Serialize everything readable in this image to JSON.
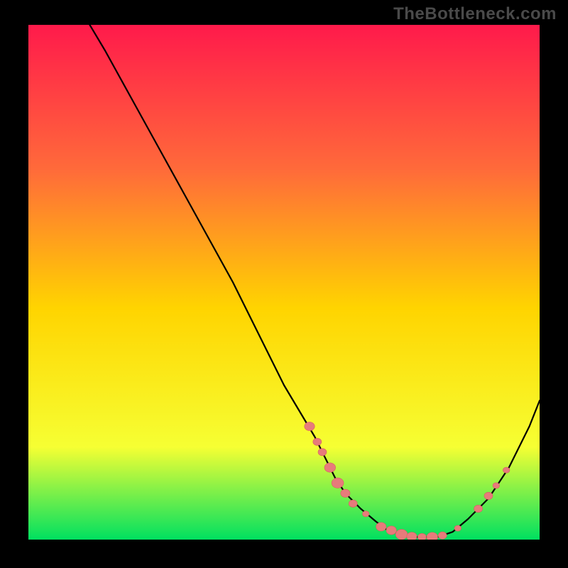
{
  "watermark": "TheBottleneck.com",
  "colors": {
    "gradient_top": "#ff1a4b",
    "gradient_mid_upper": "#ff6a3a",
    "gradient_mid": "#ffd400",
    "gradient_mid_lower": "#f6ff33",
    "gradient_bottom": "#00e060",
    "curve": "#000000",
    "marker": "#e77b7b",
    "marker_stroke": "#d85f5f"
  },
  "chart_data": {
    "type": "line",
    "title": "",
    "xlabel": "",
    "ylabel": "",
    "xlim": [
      0,
      100
    ],
    "ylim": [
      0,
      100
    ],
    "grid": false,
    "legend": false,
    "series": [
      {
        "name": "curve",
        "x": [
          12,
          15,
          20,
          25,
          30,
          35,
          40,
          45,
          48,
          50,
          53,
          56,
          58,
          60,
          62,
          65,
          68,
          70,
          73,
          76,
          80,
          83,
          86,
          90,
          94,
          98,
          100
        ],
        "y": [
          100,
          95,
          86,
          77,
          68,
          59,
          50,
          40,
          34,
          30,
          25,
          20,
          16,
          12,
          9,
          6,
          3.5,
          2,
          1,
          0.5,
          0.5,
          1.5,
          4,
          8,
          14,
          22,
          27
        ]
      }
    ],
    "markers": [
      {
        "x": 55.0,
        "y": 22.0,
        "r": 1.2
      },
      {
        "x": 56.5,
        "y": 19.0,
        "r": 1.0
      },
      {
        "x": 57.5,
        "y": 17.0,
        "r": 1.0
      },
      {
        "x": 59.0,
        "y": 14.0,
        "r": 1.3
      },
      {
        "x": 60.5,
        "y": 11.0,
        "r": 1.4
      },
      {
        "x": 62.0,
        "y": 9.0,
        "r": 1.1
      },
      {
        "x": 63.5,
        "y": 7.0,
        "r": 1.0
      },
      {
        "x": 66.0,
        "y": 5.0,
        "r": 0.8
      },
      {
        "x": 69.0,
        "y": 2.5,
        "r": 1.2
      },
      {
        "x": 71.0,
        "y": 1.8,
        "r": 1.2
      },
      {
        "x": 73.0,
        "y": 1.0,
        "r": 1.4
      },
      {
        "x": 75.0,
        "y": 0.6,
        "r": 1.2
      },
      {
        "x": 77.0,
        "y": 0.5,
        "r": 1.0
      },
      {
        "x": 79.0,
        "y": 0.5,
        "r": 1.3
      },
      {
        "x": 81.0,
        "y": 0.8,
        "r": 1.0
      },
      {
        "x": 84.0,
        "y": 2.2,
        "r": 0.8
      },
      {
        "x": 88.0,
        "y": 6.0,
        "r": 1.0
      },
      {
        "x": 90.0,
        "y": 8.5,
        "r": 1.0
      },
      {
        "x": 91.5,
        "y": 10.5,
        "r": 0.8
      },
      {
        "x": 93.5,
        "y": 13.5,
        "r": 0.8
      }
    ]
  }
}
